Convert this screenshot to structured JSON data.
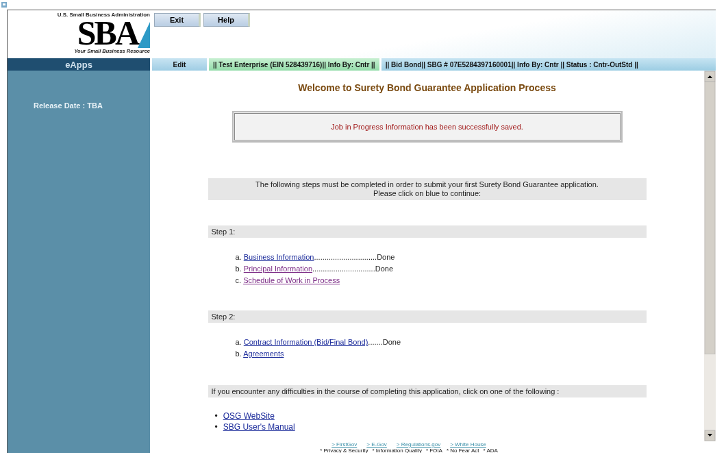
{
  "logo": {
    "agency": "U.S. Small Business Administration",
    "mark": "SBA",
    "tagline": "Your Small Business Resource"
  },
  "header_buttons": [
    "Exit",
    "Help"
  ],
  "nav": {
    "app": "eApps",
    "edit": "Edit",
    "enterprise": "|| Test Enterprise (EIN 528439716)|| Info By:  Cntr ||",
    "bond": "|| Bid Bond|| SBG # 07E5284397160001|| Info By:  Cntr || Status :  Cntr-OutStd ||"
  },
  "sidebar": {
    "release": "Release Date : TBA"
  },
  "title": "Welcome to Surety Bond Guarantee Application Process",
  "message": "Job in Progress Information has been successfully saved.",
  "instructions": [
    "The following steps must be completed in order to submit your first Surety Bond Guarantee application.",
    "Please click on blue to continue:"
  ],
  "steps": [
    {
      "label": "Step 1:",
      "items": [
        {
          "letter": "a.",
          "link": "Business Information",
          "leader": "..............................",
          "status": "Done",
          "visited": false
        },
        {
          "letter": "b.",
          "link": "Principal Information",
          "leader": "..............................",
          "status": "Done",
          "visited": true
        },
        {
          "letter": "c.",
          "link": "Schedule of Work in Process",
          "visited": true
        }
      ]
    },
    {
      "label": "Step 2:",
      "items": [
        {
          "letter": "a.",
          "link": "Contract Information (Bid/Final Bond)",
          "leader": ".......",
          "status": "Done",
          "visited": false
        },
        {
          "letter": "b.",
          "link": "Agreements",
          "visited": false
        }
      ]
    }
  ],
  "help_text": "If you encounter any difficulties in the course of completing this application, click on one of the following :",
  "help_links": [
    {
      "bullet": "•",
      "label": "OSG WebSite"
    },
    {
      "bullet": "•",
      "label": "SBG User's Manual"
    }
  ],
  "footer_links": [
    "> FirstGov",
    "> E-Gov",
    "> Regulations.gov",
    "> White House"
  ],
  "footer_policies": [
    "* Privacy & Security",
    "* Information Quality",
    "* FOIA",
    "* No Fear Act",
    "* ADA"
  ]
}
